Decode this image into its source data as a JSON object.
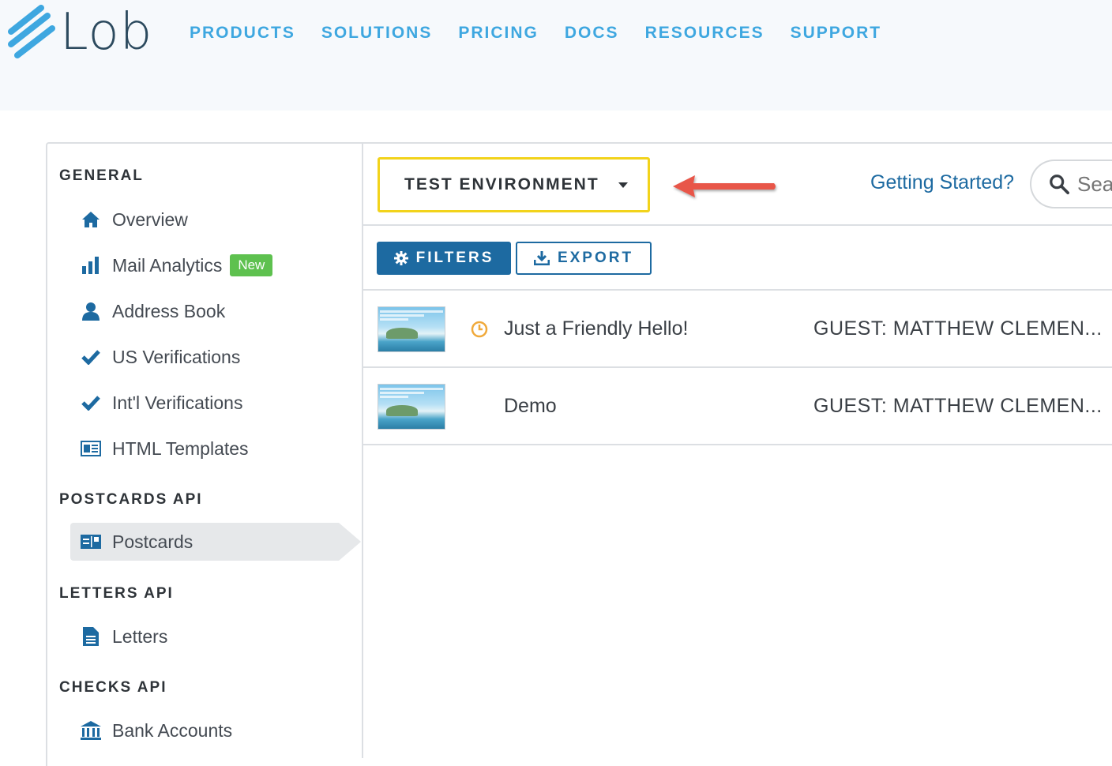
{
  "brand": {
    "name": "Lob",
    "color": "#3ea7e0"
  },
  "nav": [
    "PRODUCTS",
    "SOLUTIONS",
    "PRICING",
    "DOCS",
    "RESOURCES",
    "SUPPORT"
  ],
  "sidebar": {
    "sections": [
      {
        "title": "GENERAL"
      },
      {
        "title": "POSTCARDS API"
      },
      {
        "title": "LETTERS API"
      },
      {
        "title": "CHECKS API"
      }
    ],
    "items": [
      {
        "label": "Overview",
        "icon": "home-icon"
      },
      {
        "label": "Mail Analytics",
        "icon": "bar-chart-icon",
        "badge": "New"
      },
      {
        "label": "Address Book",
        "icon": "person-icon"
      },
      {
        "label": "US Verifications",
        "icon": "checkmark-icon"
      },
      {
        "label": "Int'l Verifications",
        "icon": "checkmark-icon"
      },
      {
        "label": "HTML Templates",
        "icon": "template-icon"
      },
      {
        "label": "Postcards",
        "icon": "postcard-icon",
        "active": true
      },
      {
        "label": "Letters",
        "icon": "document-icon"
      },
      {
        "label": "Bank Accounts",
        "icon": "bank-icon"
      }
    ]
  },
  "environment": {
    "label": "TEST ENVIRONMENT",
    "highlight_color": "#f2d31b"
  },
  "header": {
    "getting_started": "Getting Started?",
    "search_placeholder": "Sea"
  },
  "toolbar": {
    "filters_label": "FILTERS",
    "export_label": "EXPORT"
  },
  "postcards": [
    {
      "name": "Just a Friendly Hello!",
      "to": "GUEST: MATTHEW CLEMEN...",
      "status_icon": "clock-icon"
    },
    {
      "name": "Demo",
      "to": "GUEST: MATTHEW CLEMEN..."
    }
  ],
  "colors": {
    "primary": "#1d6aa1",
    "badge_green": "#5ec14f",
    "arrow_red": "#e8574a",
    "clock_orange": "#f0a93a"
  }
}
